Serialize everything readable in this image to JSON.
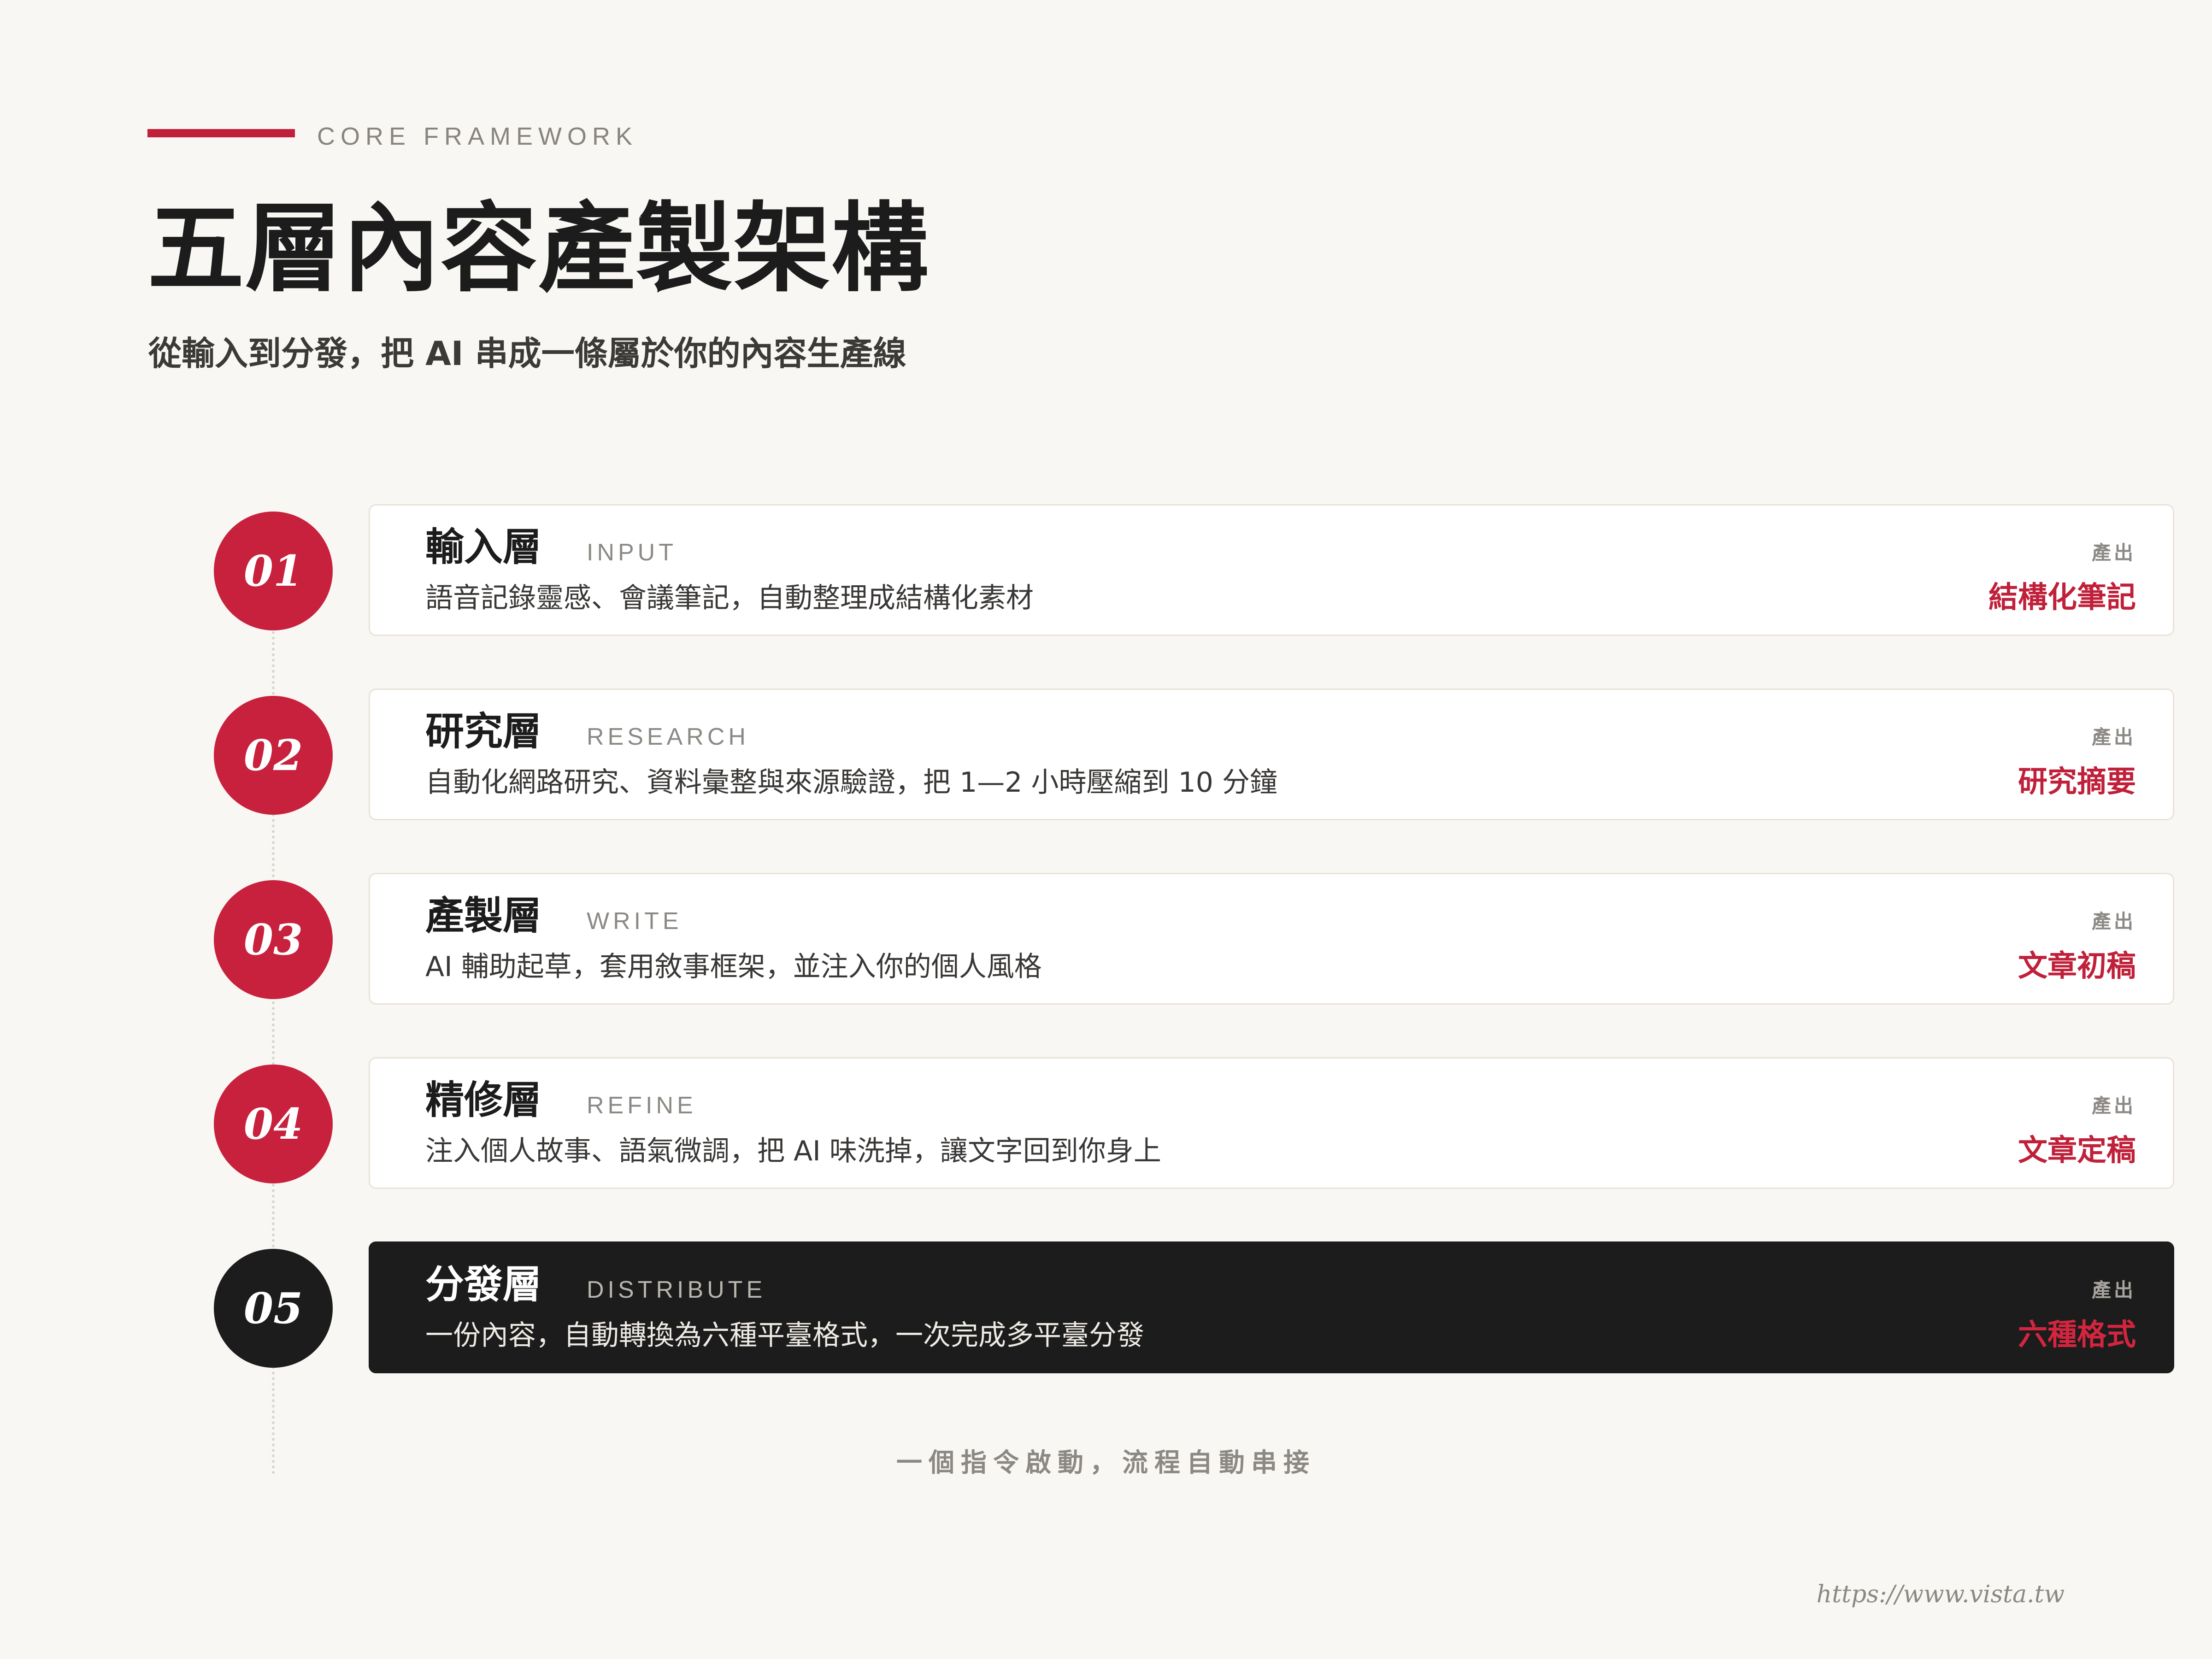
{
  "header": {
    "eyebrow": "CORE FRAMEWORK",
    "title": "五層內容產製架構",
    "subtitle": "從輸入到分發，把 AI 串成一條屬於你的內容生產線"
  },
  "colors": {
    "accent": "#c0203a",
    "background": "#f9f7f3",
    "dark": "#1c1c1c"
  },
  "layers": [
    {
      "number": "01",
      "name": "輸入層",
      "en": "INPUT",
      "desc": "語音記錄靈感、會議筆記，自動整理成結構化素材",
      "output_label": "產出",
      "output": "結構化筆記"
    },
    {
      "number": "02",
      "name": "研究層",
      "en": "RESEARCH",
      "desc": "自動化網路研究、資料彙整與來源驗證，把 1—2 小時壓縮到 10 分鐘",
      "output_label": "產出",
      "output": "研究摘要"
    },
    {
      "number": "03",
      "name": "產製層",
      "en": "WRITE",
      "desc": "AI 輔助起草，套用敘事框架，並注入你的個人風格",
      "output_label": "產出",
      "output": "文章初稿"
    },
    {
      "number": "04",
      "name": "精修層",
      "en": "REFINE",
      "desc": "注入個人故事、語氣微調，把 AI 味洗掉，讓文字回到你身上",
      "output_label": "產出",
      "output": "文章定稿"
    },
    {
      "number": "05",
      "name": "分發層",
      "en": "DISTRIBUTE",
      "desc": "一份內容，自動轉換為六種平臺格式，一次完成多平臺分發",
      "output_label": "產出",
      "output": "六種格式"
    }
  ],
  "footer": {
    "note": "一個指令啟動，流程自動串接",
    "url": "https://www.vista.tw"
  }
}
